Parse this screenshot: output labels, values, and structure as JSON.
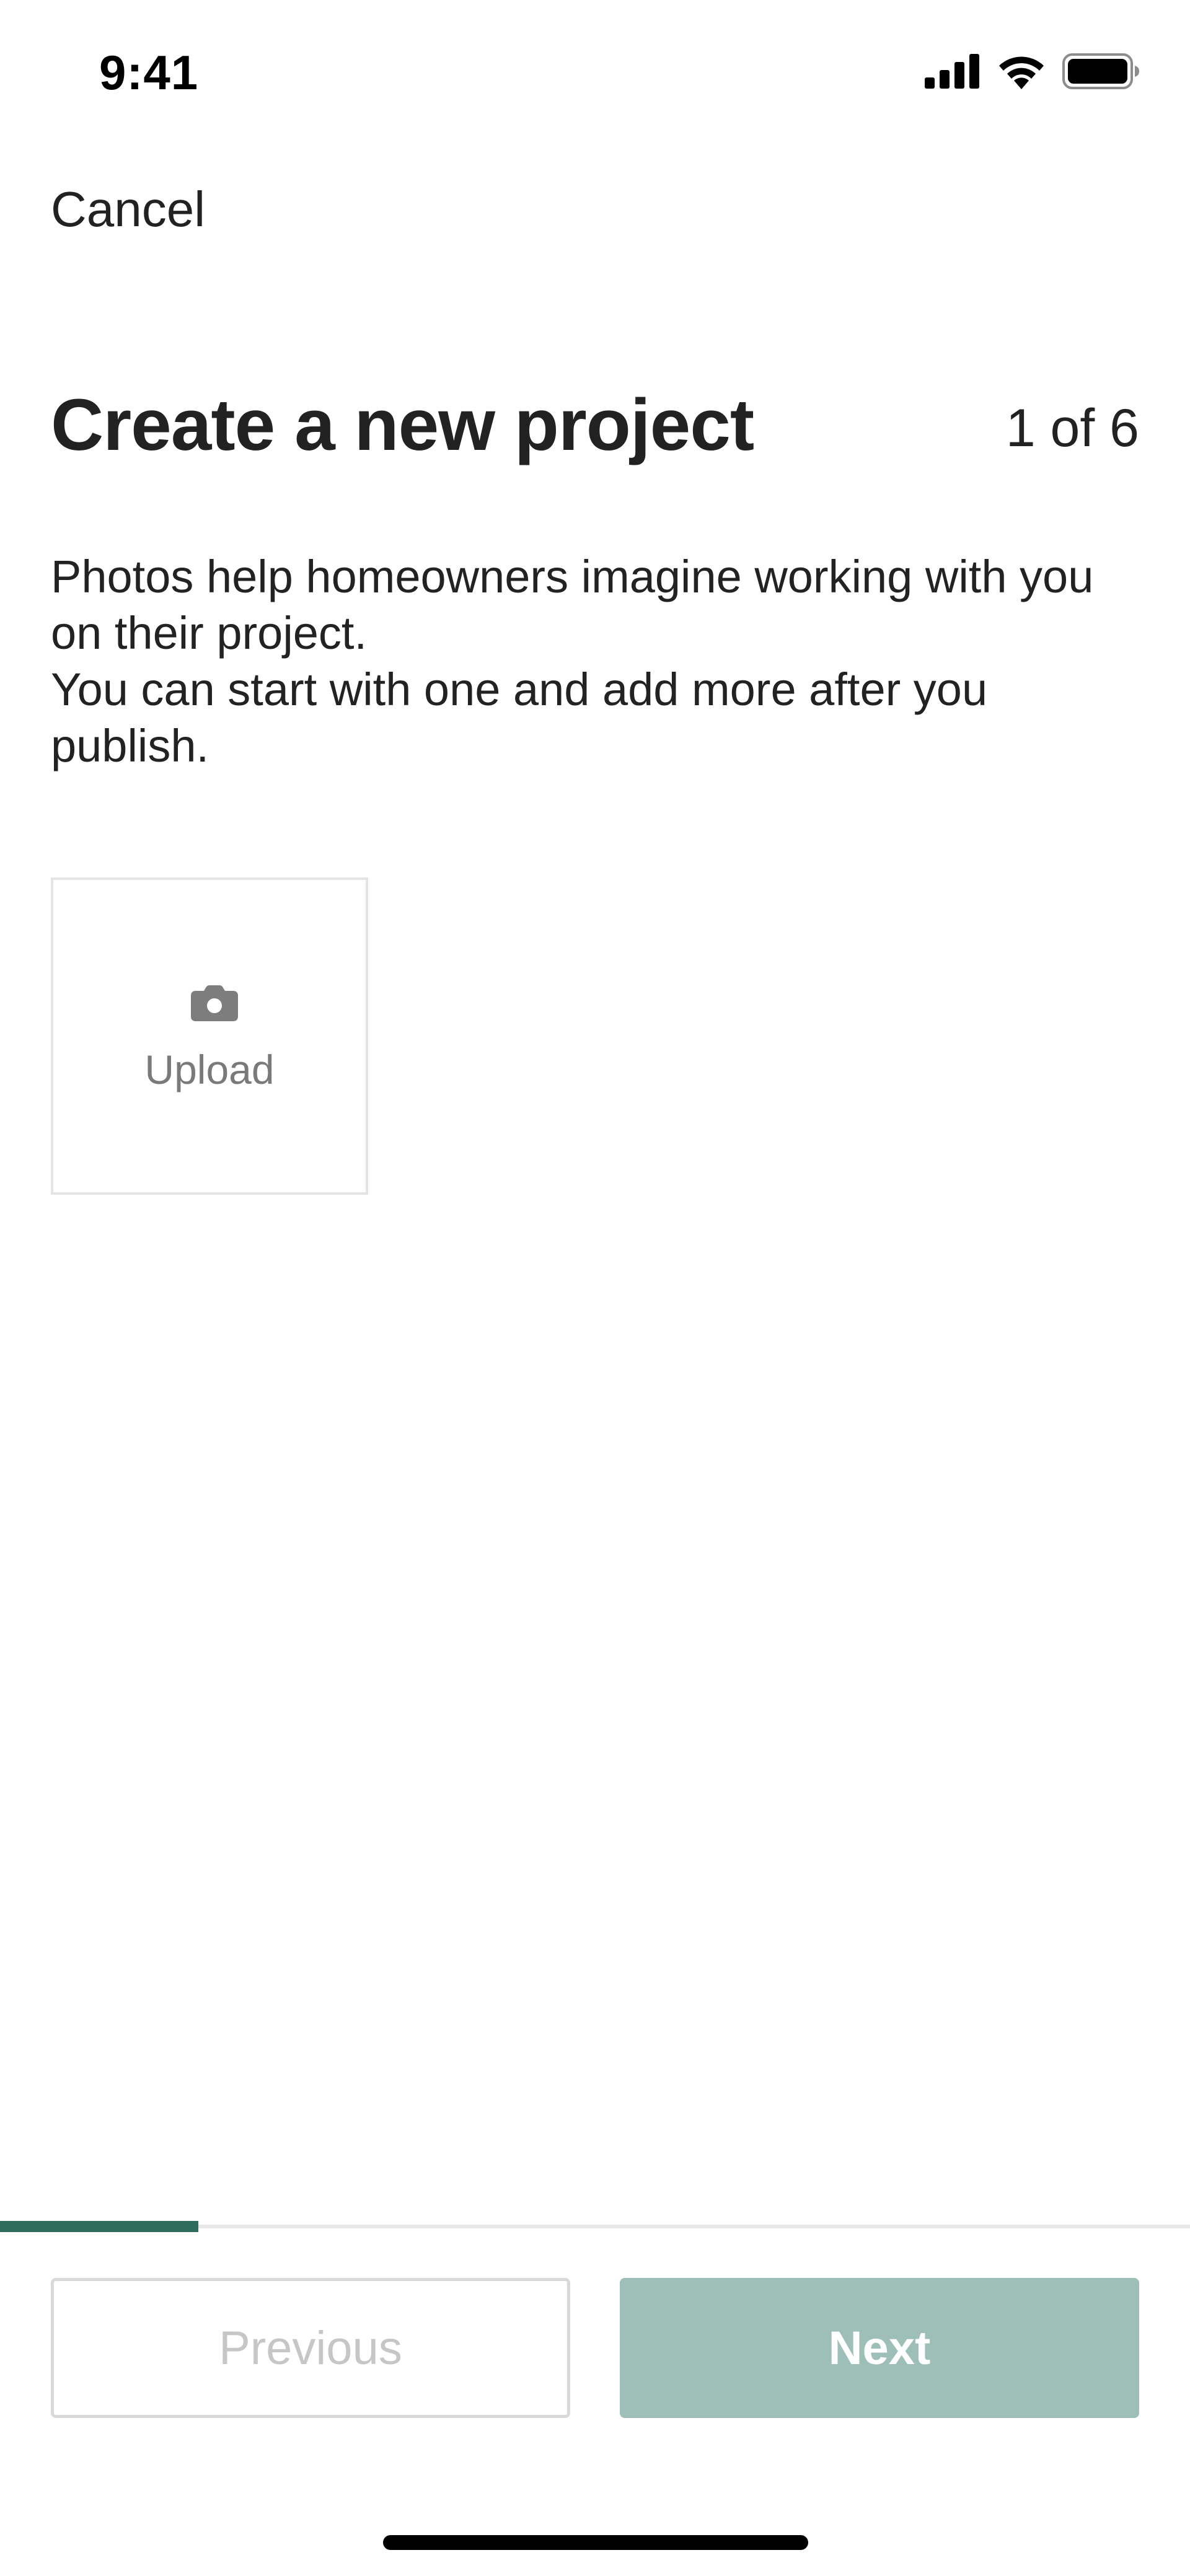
{
  "status_bar": {
    "time": "9:41",
    "icons": [
      "cellular-signal-icon",
      "wifi-icon",
      "battery-icon"
    ]
  },
  "nav": {
    "cancel_label": "Cancel"
  },
  "header": {
    "title": "Create a new project",
    "step_counter": "1 of 6",
    "current_step": 1,
    "total_steps": 6
  },
  "description": {
    "line1": "Photos help homeowners imagine working with you on their project.",
    "line2": "You can start with one and add more after you publish."
  },
  "upload": {
    "icon": "camera-icon",
    "label": "Upload"
  },
  "progress": {
    "fraction": 0.1667,
    "fill_color": "#2f6b5c"
  },
  "footer": {
    "previous_label": "Previous",
    "next_label": "Next",
    "next_color": "#9dbfb7"
  }
}
